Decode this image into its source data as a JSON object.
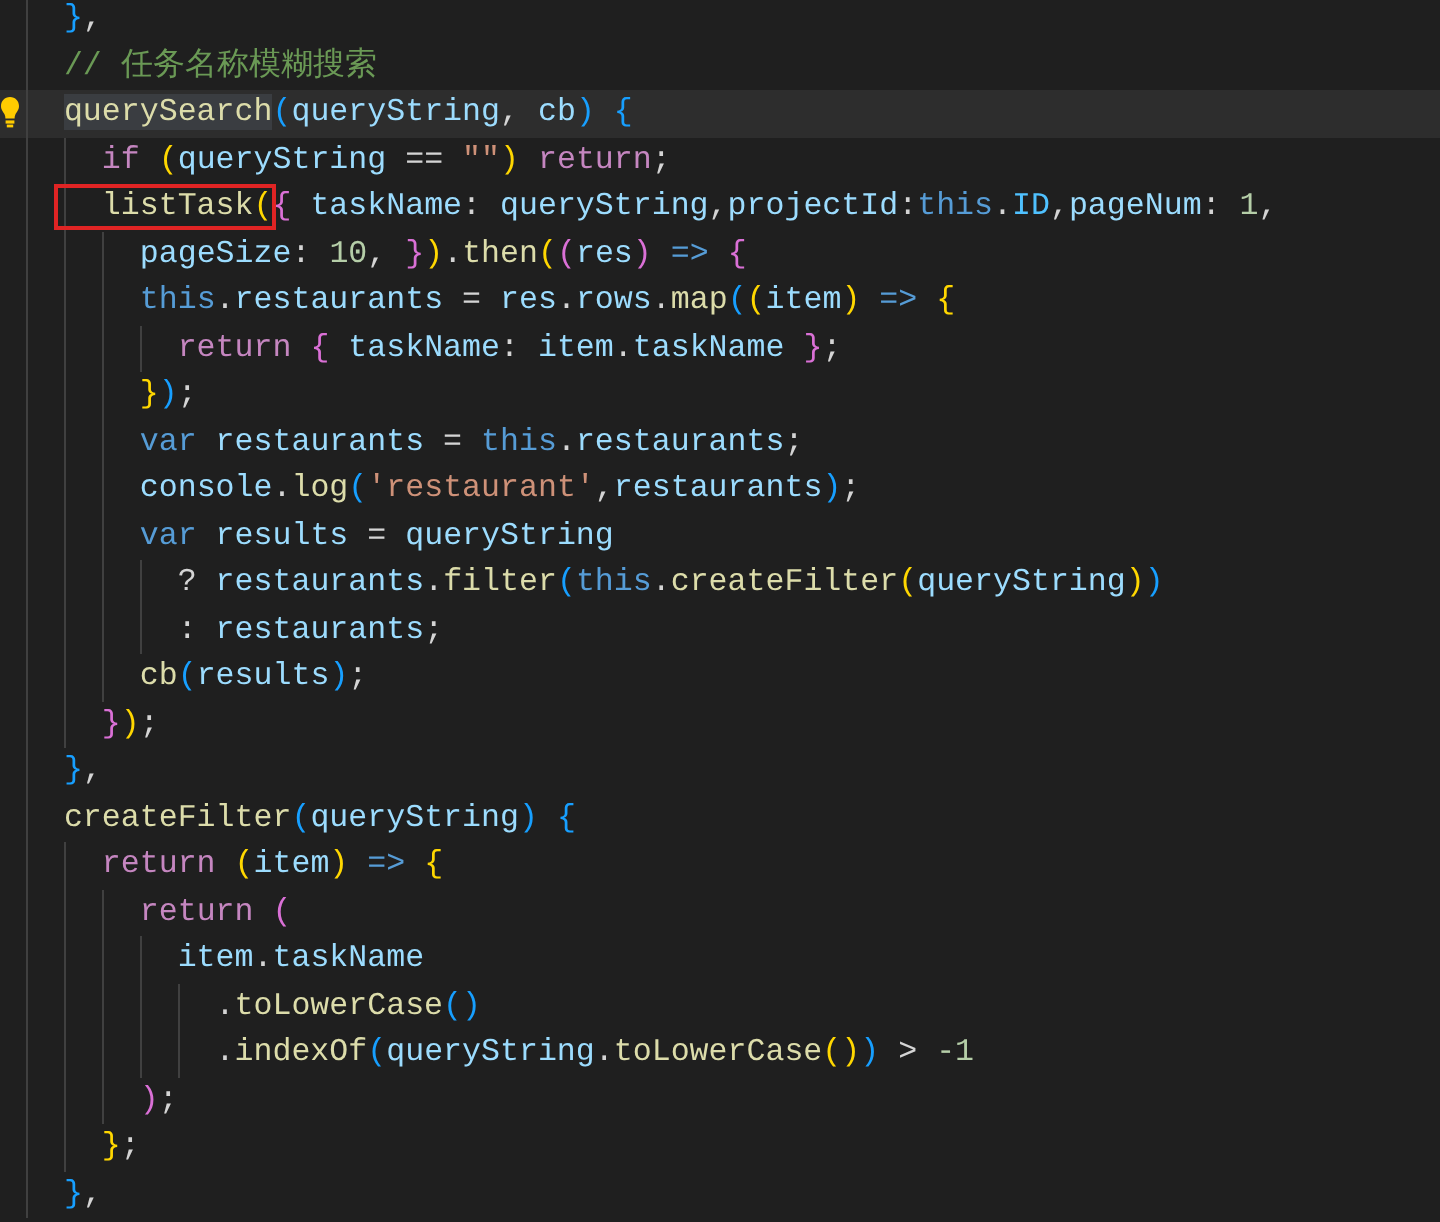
{
  "editor": {
    "lines": [
      {
        "tokens": [
          {
            "text": "  }",
            "kind": "bracket3"
          },
          {
            "text": ",",
            "kind": "plain"
          }
        ]
      },
      {
        "tokens": [
          {
            "text": "  // 任务名称模糊搜索",
            "kind": "comment"
          }
        ]
      },
      {
        "current": true,
        "lightbulb": true,
        "tokens": [
          {
            "text": "  querySearch",
            "kind": "function",
            "highlighted": true
          },
          {
            "text": "(",
            "kind": "bracket3"
          },
          {
            "text": "queryString",
            "kind": "variable"
          },
          {
            "text": ", ",
            "kind": "plain"
          },
          {
            "text": "cb",
            "kind": "variable"
          },
          {
            "text": ") ",
            "kind": "bracket3"
          },
          {
            "text": "{",
            "kind": "bracket3"
          }
        ]
      },
      {
        "tokens": [
          {
            "text": "    if ",
            "kind": "control"
          },
          {
            "text": "(",
            "kind": "bracket1"
          },
          {
            "text": "queryString",
            "kind": "variable"
          },
          {
            "text": " == ",
            "kind": "plain"
          },
          {
            "text": "\"\"",
            "kind": "string"
          },
          {
            "text": ") ",
            "kind": "bracket1"
          },
          {
            "text": "return",
            "kind": "control"
          },
          {
            "text": ";",
            "kind": "plain"
          }
        ]
      },
      {
        "tokens": [
          {
            "text": "    listTask",
            "kind": "function",
            "boxed": true
          },
          {
            "text": "(",
            "kind": "bracket1",
            "boxed": true
          },
          {
            "text": "{ ",
            "kind": "bracket2"
          },
          {
            "text": "taskName",
            "kind": "variable"
          },
          {
            "text": ": ",
            "kind": "plain"
          },
          {
            "text": "queryString",
            "kind": "variable"
          },
          {
            "text": ",",
            "kind": "plain"
          },
          {
            "text": "projectId",
            "kind": "variable"
          },
          {
            "text": ":",
            "kind": "plain"
          },
          {
            "text": "this",
            "kind": "storage"
          },
          {
            "text": ".",
            "kind": "plain"
          },
          {
            "text": "ID",
            "kind": "constant"
          },
          {
            "text": ",",
            "kind": "plain"
          },
          {
            "text": "pageNum",
            "kind": "variable"
          },
          {
            "text": ": ",
            "kind": "plain"
          },
          {
            "text": "1",
            "kind": "number"
          },
          {
            "text": ",",
            "kind": "plain"
          }
        ]
      },
      {
        "tokens": [
          {
            "text": "      pageSize",
            "kind": "variable"
          },
          {
            "text": ": ",
            "kind": "plain"
          },
          {
            "text": "10",
            "kind": "number"
          },
          {
            "text": ", ",
            "kind": "plain"
          },
          {
            "text": "}",
            "kind": "bracket2"
          },
          {
            "text": ")",
            "kind": "bracket1"
          },
          {
            "text": ".",
            "kind": "plain"
          },
          {
            "text": "then",
            "kind": "function"
          },
          {
            "text": "(",
            "kind": "bracket1"
          },
          {
            "text": "(",
            "kind": "bracket2"
          },
          {
            "text": "res",
            "kind": "variable"
          },
          {
            "text": ") ",
            "kind": "bracket2"
          },
          {
            "text": "=> ",
            "kind": "storage"
          },
          {
            "text": "{",
            "kind": "bracket2"
          }
        ]
      },
      {
        "tokens": [
          {
            "text": "      this",
            "kind": "storage"
          },
          {
            "text": ".",
            "kind": "plain"
          },
          {
            "text": "restaurants",
            "kind": "variable"
          },
          {
            "text": " = ",
            "kind": "plain"
          },
          {
            "text": "res",
            "kind": "variable"
          },
          {
            "text": ".",
            "kind": "plain"
          },
          {
            "text": "rows",
            "kind": "variable"
          },
          {
            "text": ".",
            "kind": "plain"
          },
          {
            "text": "map",
            "kind": "function"
          },
          {
            "text": "(",
            "kind": "bracket3"
          },
          {
            "text": "(",
            "kind": "bracket1"
          },
          {
            "text": "item",
            "kind": "variable"
          },
          {
            "text": ") ",
            "kind": "bracket1"
          },
          {
            "text": "=> ",
            "kind": "storage"
          },
          {
            "text": "{",
            "kind": "bracket1"
          }
        ]
      },
      {
        "tokens": [
          {
            "text": "        return ",
            "kind": "control"
          },
          {
            "text": "{ ",
            "kind": "bracket2"
          },
          {
            "text": "taskName",
            "kind": "variable"
          },
          {
            "text": ": ",
            "kind": "plain"
          },
          {
            "text": "item",
            "kind": "variable"
          },
          {
            "text": ".",
            "kind": "plain"
          },
          {
            "text": "taskName ",
            "kind": "variable"
          },
          {
            "text": "}",
            "kind": "bracket2"
          },
          {
            "text": ";",
            "kind": "plain"
          }
        ]
      },
      {
        "tokens": [
          {
            "text": "      }",
            "kind": "bracket1"
          },
          {
            "text": ")",
            "kind": "bracket3"
          },
          {
            "text": ";",
            "kind": "plain"
          }
        ]
      },
      {
        "tokens": [
          {
            "text": "      var ",
            "kind": "storage"
          },
          {
            "text": "restaurants",
            "kind": "variable"
          },
          {
            "text": " = ",
            "kind": "plain"
          },
          {
            "text": "this",
            "kind": "storage"
          },
          {
            "text": ".",
            "kind": "plain"
          },
          {
            "text": "restaurants",
            "kind": "variable"
          },
          {
            "text": ";",
            "kind": "plain"
          }
        ]
      },
      {
        "tokens": [
          {
            "text": "      console",
            "kind": "variable"
          },
          {
            "text": ".",
            "kind": "plain"
          },
          {
            "text": "log",
            "kind": "function"
          },
          {
            "text": "(",
            "kind": "bracket3"
          },
          {
            "text": "'restaurant'",
            "kind": "string"
          },
          {
            "text": ",",
            "kind": "plain"
          },
          {
            "text": "restaurants",
            "kind": "variable"
          },
          {
            "text": ")",
            "kind": "bracket3"
          },
          {
            "text": ";",
            "kind": "plain"
          }
        ]
      },
      {
        "tokens": [
          {
            "text": "      var ",
            "kind": "storage"
          },
          {
            "text": "results",
            "kind": "variable"
          },
          {
            "text": " = ",
            "kind": "plain"
          },
          {
            "text": "queryString",
            "kind": "variable"
          }
        ]
      },
      {
        "tokens": [
          {
            "text": "        ? ",
            "kind": "plain"
          },
          {
            "text": "restaurants",
            "kind": "variable"
          },
          {
            "text": ".",
            "kind": "plain"
          },
          {
            "text": "filter",
            "kind": "function"
          },
          {
            "text": "(",
            "kind": "bracket3"
          },
          {
            "text": "this",
            "kind": "storage"
          },
          {
            "text": ".",
            "kind": "plain"
          },
          {
            "text": "createFilter",
            "kind": "function"
          },
          {
            "text": "(",
            "kind": "bracket1"
          },
          {
            "text": "queryString",
            "kind": "variable"
          },
          {
            "text": ")",
            "kind": "bracket1"
          },
          {
            "text": ")",
            "kind": "bracket3"
          }
        ]
      },
      {
        "tokens": [
          {
            "text": "        : ",
            "kind": "plain"
          },
          {
            "text": "restaurants",
            "kind": "variable"
          },
          {
            "text": ";",
            "kind": "plain"
          }
        ]
      },
      {
        "tokens": [
          {
            "text": "      cb",
            "kind": "function"
          },
          {
            "text": "(",
            "kind": "bracket3"
          },
          {
            "text": "results",
            "kind": "variable"
          },
          {
            "text": ")",
            "kind": "bracket3"
          },
          {
            "text": ";",
            "kind": "plain"
          }
        ]
      },
      {
        "tokens": [
          {
            "text": "    }",
            "kind": "bracket2"
          },
          {
            "text": ")",
            "kind": "bracket1"
          },
          {
            "text": ";",
            "kind": "plain"
          }
        ]
      },
      {
        "tokens": [
          {
            "text": "  }",
            "kind": "bracket3"
          },
          {
            "text": ",",
            "kind": "plain"
          }
        ]
      },
      {
        "tokens": [
          {
            "text": "  createFilter",
            "kind": "function"
          },
          {
            "text": "(",
            "kind": "bracket3"
          },
          {
            "text": "queryString",
            "kind": "variable"
          },
          {
            "text": ") ",
            "kind": "bracket3"
          },
          {
            "text": "{",
            "kind": "bracket3"
          }
        ]
      },
      {
        "tokens": [
          {
            "text": "    return ",
            "kind": "control"
          },
          {
            "text": "(",
            "kind": "bracket1"
          },
          {
            "text": "item",
            "kind": "variable"
          },
          {
            "text": ") ",
            "kind": "bracket1"
          },
          {
            "text": "=> ",
            "kind": "storage"
          },
          {
            "text": "{",
            "kind": "bracket1"
          }
        ]
      },
      {
        "tokens": [
          {
            "text": "      return ",
            "kind": "control"
          },
          {
            "text": "(",
            "kind": "bracket2"
          }
        ]
      },
      {
        "tokens": [
          {
            "text": "        item",
            "kind": "variable"
          },
          {
            "text": ".",
            "kind": "plain"
          },
          {
            "text": "taskName",
            "kind": "variable"
          }
        ]
      },
      {
        "tokens": [
          {
            "text": "          .",
            "kind": "plain"
          },
          {
            "text": "toLowerCase",
            "kind": "function"
          },
          {
            "text": "(",
            "kind": "bracket3"
          },
          {
            "text": ")",
            "kind": "bracket3"
          }
        ]
      },
      {
        "tokens": [
          {
            "text": "          .",
            "kind": "plain"
          },
          {
            "text": "indexOf",
            "kind": "function"
          },
          {
            "text": "(",
            "kind": "bracket3"
          },
          {
            "text": "queryString",
            "kind": "variable"
          },
          {
            "text": ".",
            "kind": "plain"
          },
          {
            "text": "toLowerCase",
            "kind": "function"
          },
          {
            "text": "(",
            "kind": "bracket1"
          },
          {
            "text": ")",
            "kind": "bracket1"
          },
          {
            "text": ") ",
            "kind": "bracket3"
          },
          {
            "text": "> ",
            "kind": "plain"
          },
          {
            "text": "-1",
            "kind": "number"
          }
        ]
      },
      {
        "tokens": [
          {
            "text": "      )",
            "kind": "bracket2"
          },
          {
            "text": ";",
            "kind": "plain"
          }
        ]
      },
      {
        "tokens": [
          {
            "text": "    }",
            "kind": "bracket1"
          },
          {
            "text": ";",
            "kind": "plain"
          }
        ]
      },
      {
        "tokens": [
          {
            "text": "  }",
            "kind": "bracket3"
          },
          {
            "text": ",",
            "kind": "plain"
          }
        ]
      }
    ]
  }
}
